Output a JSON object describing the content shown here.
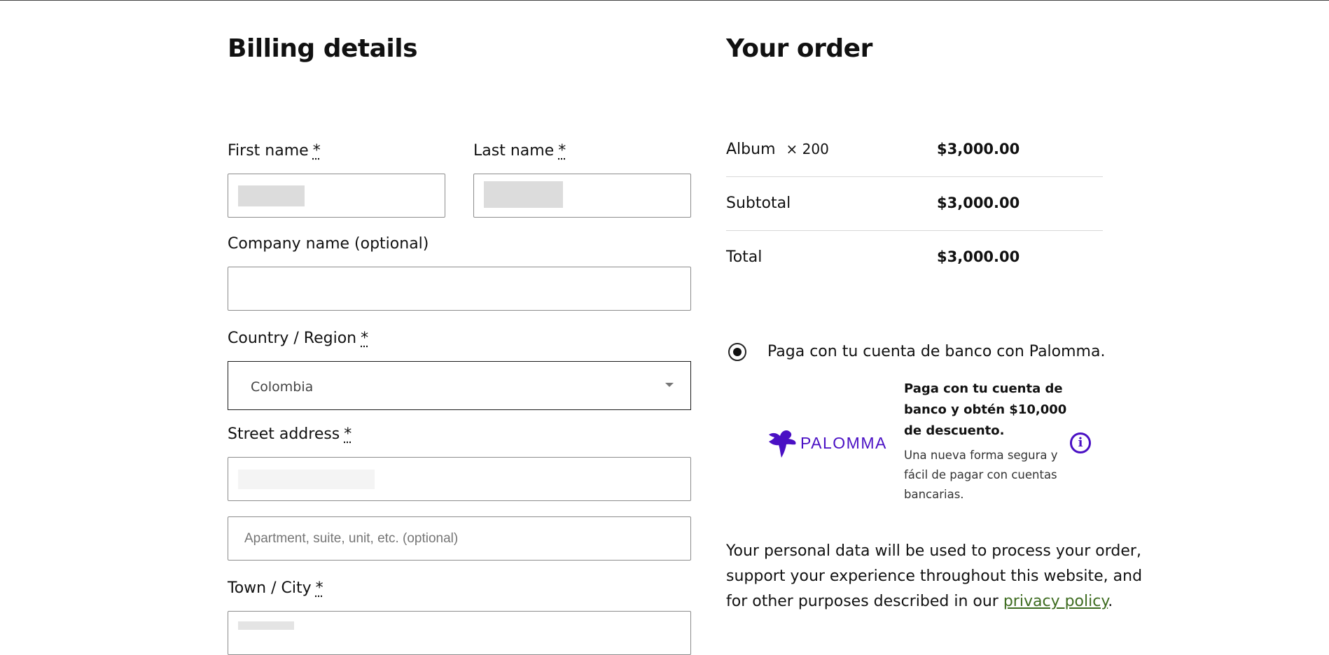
{
  "billing": {
    "title": "Billing details",
    "first_name_label": "First name",
    "last_name_label": "Last name",
    "company_label": "Company name (optional)",
    "country_label": "Country / Region",
    "country_value": "Colombia",
    "street_label": "Street address",
    "apartment_placeholder": "Apartment, suite, unit, etc. (optional)",
    "town_label": "Town / City",
    "required_mark": "*"
  },
  "order": {
    "title": "Your order",
    "item_name": "Album",
    "item_qty": "× 200",
    "item_price": "$3,000.00",
    "subtotal_label": "Subtotal",
    "subtotal_value": "$3,000.00",
    "total_label": "Total",
    "total_value": "$3,000.00"
  },
  "payment": {
    "option_label": "Paga con tu cuenta de banco con Palomma.",
    "brand": "PALOMMA",
    "promo_line1": "Paga con tu cuenta de",
    "promo_line2": "banco y obtén $10,000",
    "promo_line3": "de descuento.",
    "desc_line1": "Una nueva forma segura y",
    "desc_line2": "fácil de pagar con cuentas",
    "desc_line3": "bancarias.",
    "info_glyph": "i"
  },
  "privacy": {
    "line1": "Your personal data will be used to process your order,",
    "line2": "support your experience throughout this website, and",
    "line3_prefix": "for other purposes described in our ",
    "link_text": "privacy policy",
    "line3_suffix": "."
  },
  "colors": {
    "brand_purple": "#4a10c4",
    "link_green": "#3d6b1f"
  },
  "icons": [
    "palomma-logo-icon",
    "info-icon",
    "chevron-down-icon",
    "radio-selected-icon"
  ]
}
